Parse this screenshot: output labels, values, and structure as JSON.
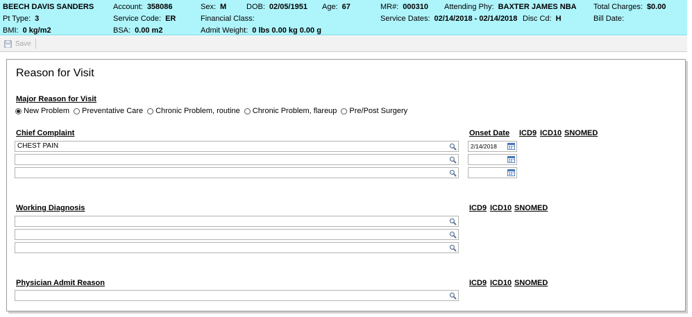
{
  "patient": {
    "name": "BEECH DAVIS SANDERS",
    "pt_type_label": "Pt Type:",
    "pt_type": "3",
    "bmi_label": "BMI:",
    "bmi": "0 kg/m2",
    "account_label": "Account:",
    "account": "358086",
    "service_code_label": "Service Code:",
    "service_code": "ER",
    "bsa_label": "BSA:",
    "bsa": "0.00 m2",
    "sex_label": "Sex:",
    "sex": "M",
    "financial_class_label": "Financial Class:",
    "admit_weight_label": "Admit Weight:",
    "admit_weight": "0 lbs 0.00 kg 0.00 g",
    "dob_label": "DOB:",
    "dob": "02/05/1951",
    "age_label": "Age:",
    "age": "67",
    "mr_label": "MR#:",
    "mr": "000310",
    "service_dates_label": "Service Dates:",
    "service_dates": "02/14/2018 - 02/14/2018",
    "attending_label": "Attending Phy:",
    "attending": "BAXTER JAMES NBA",
    "disc_cd_label": "Disc Cd:",
    "disc_cd": "H",
    "total_charges_label": "Total Charges:",
    "total_charges": "$0.00",
    "bill_date_label": "Bill Date:"
  },
  "toolbar": {
    "save_label": "Save",
    "save_icon": "floppy-disk-icon"
  },
  "form": {
    "title": "Reason for Visit",
    "major_reason": {
      "label": "Major Reason for Visit",
      "options": [
        "New Problem",
        "Preventative Care",
        "Chronic Problem, routine",
        "Chronic Problem, flareup",
        "Pre/Post Surgery"
      ],
      "selected": "New Problem"
    },
    "chief_complaint": {
      "label": "Chief Complaint",
      "values": [
        "CHEST PAIN",
        "",
        ""
      ],
      "onset_label": "Onset Date",
      "onset_dates": [
        "2/14/2018",
        "",
        ""
      ],
      "codes": [
        "ICD9",
        "ICD10",
        "SNOMED"
      ]
    },
    "working_diagnosis": {
      "label": "Working Diagnosis",
      "values": [
        "",
        "",
        ""
      ],
      "codes": [
        "ICD9",
        "ICD10",
        "SNOMED"
      ]
    },
    "physician_admit_reason": {
      "label": "Physician Admit Reason",
      "values": [
        ""
      ],
      "codes": [
        "ICD9",
        "ICD10",
        "SNOMED"
      ]
    }
  },
  "icons": {
    "lookup": "magnifier-icon",
    "calendar": "calendar-icon"
  },
  "colors": {
    "header_bg": "#aef4fb",
    "toolbar_bg": "#f2f2f2",
    "panel_border": "#9a9a9a"
  }
}
